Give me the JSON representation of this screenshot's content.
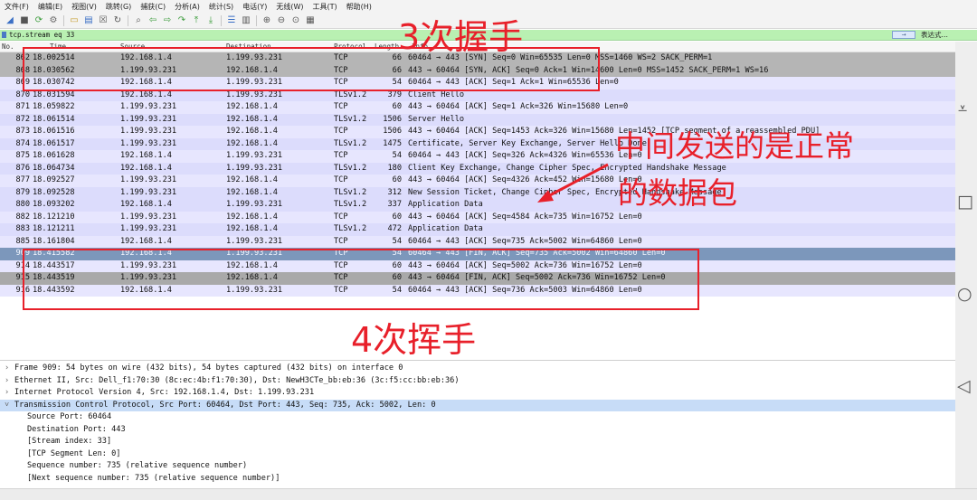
{
  "menu": [
    "文件(F)",
    "编辑(E)",
    "视图(V)",
    "跳转(G)",
    "捕获(C)",
    "分析(A)",
    "统计(S)",
    "电话(Y)",
    "无线(W)",
    "工具(T)",
    "帮助(H)"
  ],
  "toolbar_icons": [
    "shark-fin-start-icon",
    "stop-icon",
    "restart-icon",
    "options-gear-icon",
    "open-folder-icon",
    "save-file-icon",
    "close-file-icon",
    "reload-icon",
    "find-icon",
    "go-back-icon",
    "go-forward-icon",
    "go-to-packet-icon",
    "go-first-icon",
    "go-last-icon",
    "autoscroll-icon",
    "colorize-icon",
    "zoom-in-icon",
    "zoom-out-icon",
    "zoom-normal-icon",
    "resize-columns-icon"
  ],
  "filter": {
    "value": "tcp.stream eq 33",
    "expression_label": "表达式…"
  },
  "columns": {
    "no": "No.",
    "time": "Time",
    "source": "Source",
    "destination": "Destination",
    "protocol": "Protocol",
    "length": "Length",
    "info": "Info"
  },
  "packets": [
    {
      "no": "862",
      "time": "18.002514",
      "src": "192.168.1.4",
      "dst": "1.199.93.231",
      "proto": "TCP",
      "len": "66",
      "info": "60464 → 443 [SYN] Seq=0 Win=65535 Len=0 MSS=1460 WS=2 SACK_PERM=1",
      "style": "syn"
    },
    {
      "no": "868",
      "time": "18.030562",
      "src": "1.199.93.231",
      "dst": "192.168.1.4",
      "proto": "TCP",
      "len": "66",
      "info": "443 → 60464 [SYN, ACK] Seq=0 Ack=1 Win=14600 Len=0 MSS=1452 SACK_PERM=1 WS=16",
      "style": "syn"
    },
    {
      "no": "869",
      "time": "18.030742",
      "src": "192.168.1.4",
      "dst": "1.199.93.231",
      "proto": "TCP",
      "len": "54",
      "info": "60464 → 443 [ACK] Seq=1 Ack=1 Win=65536 Len=0",
      "style": "tcp"
    },
    {
      "no": "870",
      "time": "18.031594",
      "src": "192.168.1.4",
      "dst": "1.199.93.231",
      "proto": "TLSv1.2",
      "len": "379",
      "info": "Client Hello",
      "style": "tls"
    },
    {
      "no": "871",
      "time": "18.059822",
      "src": "1.199.93.231",
      "dst": "192.168.1.4",
      "proto": "TCP",
      "len": "60",
      "info": "443 → 60464 [ACK] Seq=1 Ack=326 Win=15680 Len=0",
      "style": "tcp"
    },
    {
      "no": "872",
      "time": "18.061514",
      "src": "1.199.93.231",
      "dst": "192.168.1.4",
      "proto": "TLSv1.2",
      "len": "1506",
      "info": "Server Hello",
      "style": "tls"
    },
    {
      "no": "873",
      "time": "18.061516",
      "src": "1.199.93.231",
      "dst": "192.168.1.4",
      "proto": "TCP",
      "len": "1506",
      "info": "443 → 60464 [ACK] Seq=1453 Ack=326 Win=15680 Len=1452 [TCP segment of a reassembled PDU]",
      "style": "tcp"
    },
    {
      "no": "874",
      "time": "18.061517",
      "src": "1.199.93.231",
      "dst": "192.168.1.4",
      "proto": "TLSv1.2",
      "len": "1475",
      "info": "Certificate, Server Key Exchange, Server Hello Done",
      "style": "tls"
    },
    {
      "no": "875",
      "time": "18.061628",
      "src": "192.168.1.4",
      "dst": "1.199.93.231",
      "proto": "TCP",
      "len": "54",
      "info": "60464 → 443 [ACK] Seq=326 Ack=4326 Win=65536 Len=0",
      "style": "tcp"
    },
    {
      "no": "876",
      "time": "18.064734",
      "src": "192.168.1.4",
      "dst": "1.199.93.231",
      "proto": "TLSv1.2",
      "len": "180",
      "info": "Client Key Exchange, Change Cipher Spec, Encrypted Handshake Message",
      "style": "tls"
    },
    {
      "no": "877",
      "time": "18.092527",
      "src": "1.199.93.231",
      "dst": "192.168.1.4",
      "proto": "TCP",
      "len": "60",
      "info": "443 → 60464 [ACK] Seq=4326 Ack=452 Win=15680 Len=0",
      "style": "tcp"
    },
    {
      "no": "879",
      "time": "18.092528",
      "src": "1.199.93.231",
      "dst": "192.168.1.4",
      "proto": "TLSv1.2",
      "len": "312",
      "info": "New Session Ticket, Change Cipher Spec, Encrypted Handshake Message",
      "style": "tls"
    },
    {
      "no": "880",
      "time": "18.093202",
      "src": "192.168.1.4",
      "dst": "1.199.93.231",
      "proto": "TLSv1.2",
      "len": "337",
      "info": "Application Data",
      "style": "tls"
    },
    {
      "no": "882",
      "time": "18.121210",
      "src": "1.199.93.231",
      "dst": "192.168.1.4",
      "proto": "TCP",
      "len": "60",
      "info": "443 → 60464 [ACK] Seq=4584 Ack=735 Win=16752 Len=0",
      "style": "tcp"
    },
    {
      "no": "883",
      "time": "18.121211",
      "src": "1.199.93.231",
      "dst": "192.168.1.4",
      "proto": "TLSv1.2",
      "len": "472",
      "info": "Application Data",
      "style": "tls"
    },
    {
      "no": "885",
      "time": "18.161804",
      "src": "192.168.1.4",
      "dst": "1.199.93.231",
      "proto": "TCP",
      "len": "54",
      "info": "60464 → 443 [ACK] Seq=735 Ack=5002 Win=64860 Len=0",
      "style": "tcp"
    },
    {
      "no": "909",
      "time": "18.415582",
      "src": "192.168.1.4",
      "dst": "1.199.93.231",
      "proto": "TCP",
      "len": "54",
      "info": "60464 → 443 [FIN, ACK] Seq=735 Ack=5002 Win=64860 Len=0",
      "style": "sel"
    },
    {
      "no": "914",
      "time": "18.443517",
      "src": "1.199.93.231",
      "dst": "192.168.1.4",
      "proto": "TCP",
      "len": "60",
      "info": "443 → 60464 [ACK] Seq=5002 Ack=736 Win=16752 Len=0",
      "style": "tcp"
    },
    {
      "no": "915",
      "time": "18.443519",
      "src": "1.199.93.231",
      "dst": "192.168.1.4",
      "proto": "TCP",
      "len": "60",
      "info": "443 → 60464 [FIN, ACK] Seq=5002 Ack=736 Win=16752 Len=0",
      "style": "fin"
    },
    {
      "no": "916",
      "time": "18.443592",
      "src": "192.168.1.4",
      "dst": "1.199.93.231",
      "proto": "TCP",
      "len": "54",
      "info": "60464 → 443 [ACK] Seq=736 Ack=5003 Win=64860 Len=0",
      "style": "tcp"
    }
  ],
  "details": [
    {
      "text": "Frame 909: 54 bytes on wire (432 bits), 54 bytes captured (432 bits) on interface 0",
      "kind": "collapsed"
    },
    {
      "text": "Ethernet II, Src: Dell_f1:70:30 (8c:ec:4b:f1:70:30), Dst: NewH3CTe_bb:eb:36 (3c:f5:cc:bb:eb:36)",
      "kind": "collapsed"
    },
    {
      "text": "Internet Protocol Version 4, Src: 192.168.1.4, Dst: 1.199.93.231",
      "kind": "collapsed"
    },
    {
      "text": "Transmission Control Protocol, Src Port: 60464, Dst Port: 443, Seq: 735, Ack: 5002, Len: 0",
      "kind": "expanded"
    },
    {
      "text": "Source Port: 60464",
      "kind": "child"
    },
    {
      "text": "Destination Port: 443",
      "kind": "child"
    },
    {
      "text": "[Stream index: 33]",
      "kind": "child"
    },
    {
      "text": "[TCP Segment Len: 0]",
      "kind": "child"
    },
    {
      "text": "Sequence number: 735    (relative sequence number)",
      "kind": "child"
    },
    {
      "text": "[Next sequence number: 735    (relative sequence number)]",
      "kind": "child"
    }
  ],
  "annotations": {
    "handshake": "3次握手",
    "middle_line1": "中间发送的是正常",
    "middle_line2": "的数据包",
    "wave": "4次挥手"
  },
  "colors": {
    "annotation_red": "#e8202a",
    "filter_green": "#b9f0b2",
    "selected_row": "#7c97bb",
    "tls_row": "#dcdcfc",
    "tcp_row": "#e7e6fe",
    "syn_row": "#b5b5b5",
    "fin_row": "#a9a9a9"
  }
}
